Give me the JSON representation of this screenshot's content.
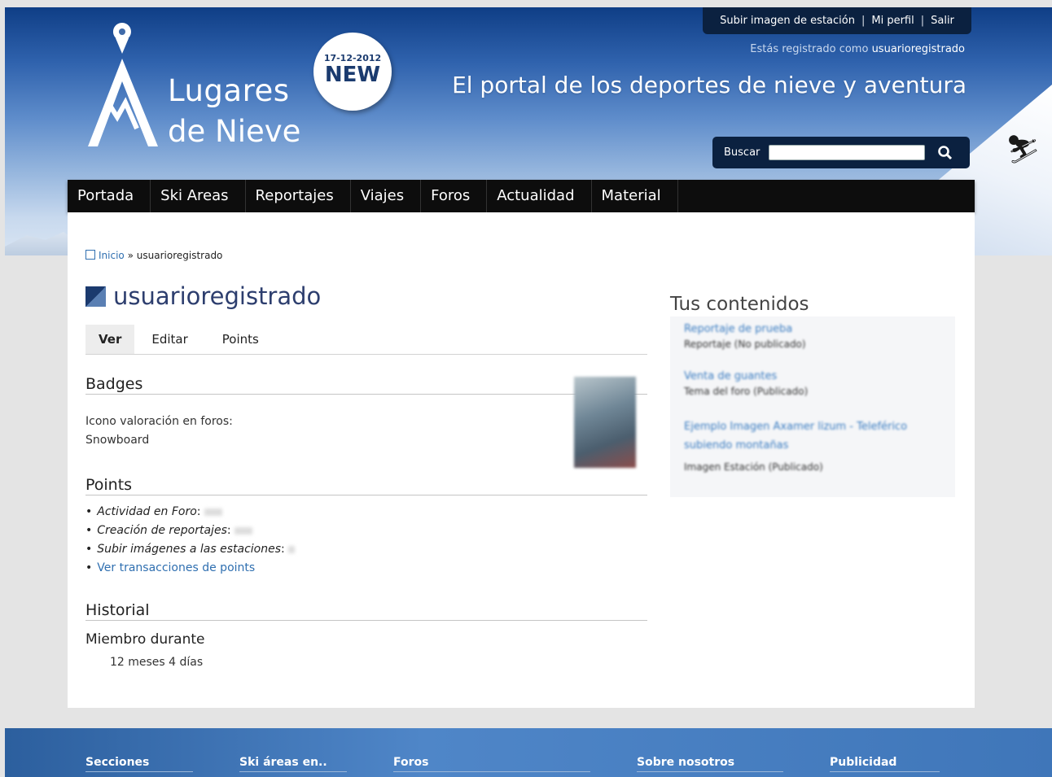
{
  "header": {
    "logo_line1": "Lugares",
    "logo_line2": "de Nieve",
    "badge_date": "17-12-2012",
    "badge_new": "NEW",
    "top_links": [
      "Subir imagen de estación",
      "Mi perfil",
      "Salir"
    ],
    "logged_prefix": "Estás registrado como",
    "logged_user": "usuarioregistrado",
    "slogan": "El portal de los deportes de nieve y aventura",
    "search_label": "Buscar",
    "search_value": ""
  },
  "nav": [
    "Portada",
    "Ski Areas",
    "Reportajes",
    "Viajes",
    "Foros",
    "Actualidad",
    "Material"
  ],
  "breadcrumb": {
    "home": "Inicio",
    "sep": "»",
    "current": "usuarioregistrado"
  },
  "page_title": "usuarioregistrado",
  "tabs": [
    "Ver",
    "Editar",
    "Points"
  ],
  "badges": {
    "heading": "Badges",
    "label": "Icono valoración en foros:",
    "value": "Snowboard"
  },
  "points": {
    "heading": "Points",
    "items": [
      "Actividad en Foro",
      "Creación de reportajes",
      "Subir imágenes a las estaciones"
    ],
    "link": "Ver transacciones de points"
  },
  "historial": {
    "heading": "Historial",
    "sub": "Miembro durante",
    "value": "12 meses 4 días"
  },
  "sidebar": {
    "heading": "Tus contenidos",
    "items": [
      {
        "title": "Reportaje de prueba",
        "meta": "Reportaje (No publicado)"
      },
      {
        "title": "Venta de guantes",
        "meta": "Tema del foro (Publicado)"
      },
      {
        "title": "Ejemplo Imagen Axamer lizum - Teleférico subiendo montañas",
        "meta": "Imagen Estación (Publicado)"
      }
    ]
  },
  "footer": [
    "Secciones",
    "Ski áreas en..",
    "Foros",
    "Sobre nosotros",
    "Publicidad"
  ],
  "colors": {
    "nav_bg": "#0d0d0d",
    "link": "#2f6fb0",
    "title": "#2d3e6e",
    "footer": "#3f76b9"
  }
}
